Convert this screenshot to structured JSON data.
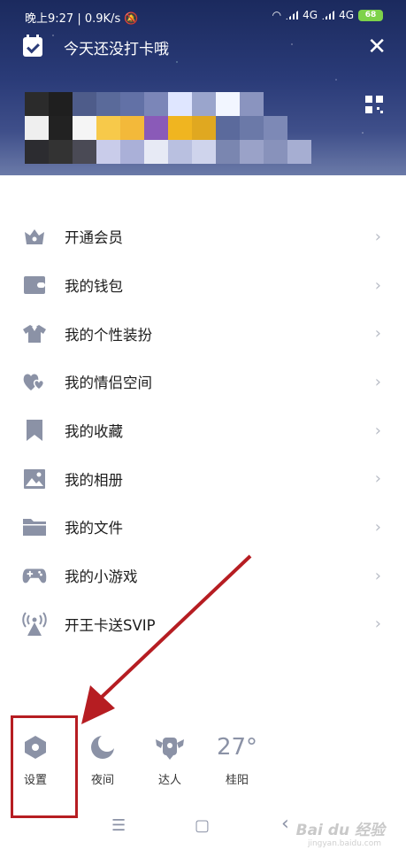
{
  "status_bar": {
    "time": "晚上9:27",
    "speed": "0.9K/s",
    "network1": "4G",
    "network2": "4G",
    "battery": "68"
  },
  "header": {
    "checkin_text": "今天还没打卡哦",
    "close_icon": "close-icon",
    "qr_icon": "qr-code-icon"
  },
  "menu": {
    "items": [
      {
        "label": "开通会员",
        "icon": "crown-icon"
      },
      {
        "label": "我的钱包",
        "icon": "wallet-icon"
      },
      {
        "label": "我的个性装扮",
        "icon": "shirt-icon"
      },
      {
        "label": "我的情侣空间",
        "icon": "hearts-icon"
      },
      {
        "label": "我的收藏",
        "icon": "bookmark-icon"
      },
      {
        "label": "我的相册",
        "icon": "photo-icon"
      },
      {
        "label": "我的文件",
        "icon": "folder-icon"
      },
      {
        "label": "我的小游戏",
        "icon": "gamepad-icon"
      },
      {
        "label": "开王卡送SVIP",
        "icon": "broadcast-icon"
      }
    ],
    "chevron": "›"
  },
  "bottom": {
    "settings_label": "设置",
    "night_label": "夜间",
    "talent_label": "达人",
    "temperature": "27°",
    "city": "桂阳"
  },
  "nav": {
    "menu": "☰",
    "home": "▢",
    "back": "‹"
  },
  "watermark": {
    "brand": "Bai du 经验",
    "url": "jingyan.baidu.com"
  },
  "colors": {
    "icon_gray": "#8b92a6",
    "annotation_red": "#b61d22"
  }
}
